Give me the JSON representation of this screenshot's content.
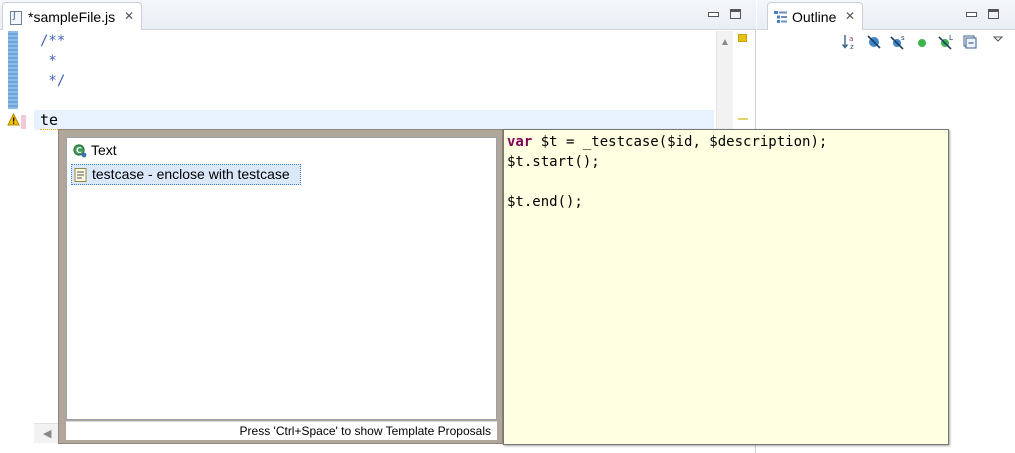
{
  "editor": {
    "tab_label": "*sampleFile.js",
    "code_lines": [
      "/**",
      " *",
      " */",
      ""
    ],
    "typed_text": "te"
  },
  "outline": {
    "tab_label": "Outline"
  },
  "assist": {
    "items": [
      {
        "label": "Text",
        "icon": "template-variable-icon"
      },
      {
        "label": "testcase - enclose with testcase",
        "icon": "template-icon"
      }
    ],
    "status": "Press 'Ctrl+Space' to show Template Proposals",
    "info": {
      "keyword": "var",
      "line1_rest": " $t = _testcase($id, $description);",
      "line2": "$t.start();",
      "line3": "",
      "line4": "$t.end();"
    }
  },
  "colors": {
    "comment": "#3f5fbf",
    "keyword": "#7f0055",
    "info_bg": "#ffffe1",
    "current_line": "#e8f2fe"
  }
}
